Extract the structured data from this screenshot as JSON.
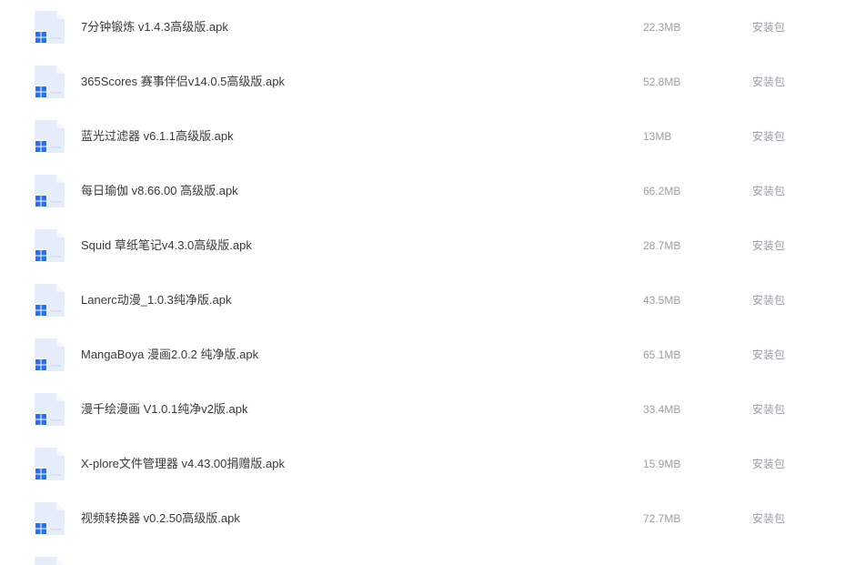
{
  "files": [
    {
      "name": "7分钟锻炼 v1.4.3高级版.apk",
      "size": "22.3MB",
      "type": "安装包",
      "icon": "apk-file-icon"
    },
    {
      "name": "365Scores 赛事伴侣v14.0.5高级版.apk",
      "size": "52.8MB",
      "type": "安装包",
      "icon": "apk-file-icon"
    },
    {
      "name": "蓝光过滤器 v6.1.1高级版.apk",
      "size": "13MB",
      "type": "安装包",
      "icon": "apk-file-icon"
    },
    {
      "name": "每日瑜伽 v8.66.00 高级版.apk",
      "size": "66.2MB",
      "type": "安装包",
      "icon": "apk-file-icon"
    },
    {
      "name": "Squid 草纸笔记v4.3.0高级版.apk",
      "size": "28.7MB",
      "type": "安装包",
      "icon": "apk-file-icon"
    },
    {
      "name": "Lanerc动漫_1.0.3纯净版.apk",
      "size": "43.5MB",
      "type": "安装包",
      "icon": "apk-file-icon"
    },
    {
      "name": "MangaBoya 漫画2.0.2 纯净版.apk",
      "size": "65.1MB",
      "type": "安装包",
      "icon": "apk-file-icon"
    },
    {
      "name": "漫千绘漫画 V1.0.1纯净v2版.apk",
      "size": "33.4MB",
      "type": "安装包",
      "icon": "apk-file-icon"
    },
    {
      "name": "X-plore文件管理器 v4.43.00捐赠版.apk",
      "size": "15.9MB",
      "type": "安装包",
      "icon": "apk-file-icon"
    },
    {
      "name": "视频转换器 v0.2.50高级版.apk",
      "size": "72.7MB",
      "type": "安装包",
      "icon": "apk-file-icon"
    }
  ],
  "colors": {
    "name_text": "#3a3a3a",
    "meta_text": "#9a9ea6",
    "icon_body": "#e6edfa",
    "icon_fold": "#f4f7fd",
    "icon_grid": "#2f6ee3"
  }
}
